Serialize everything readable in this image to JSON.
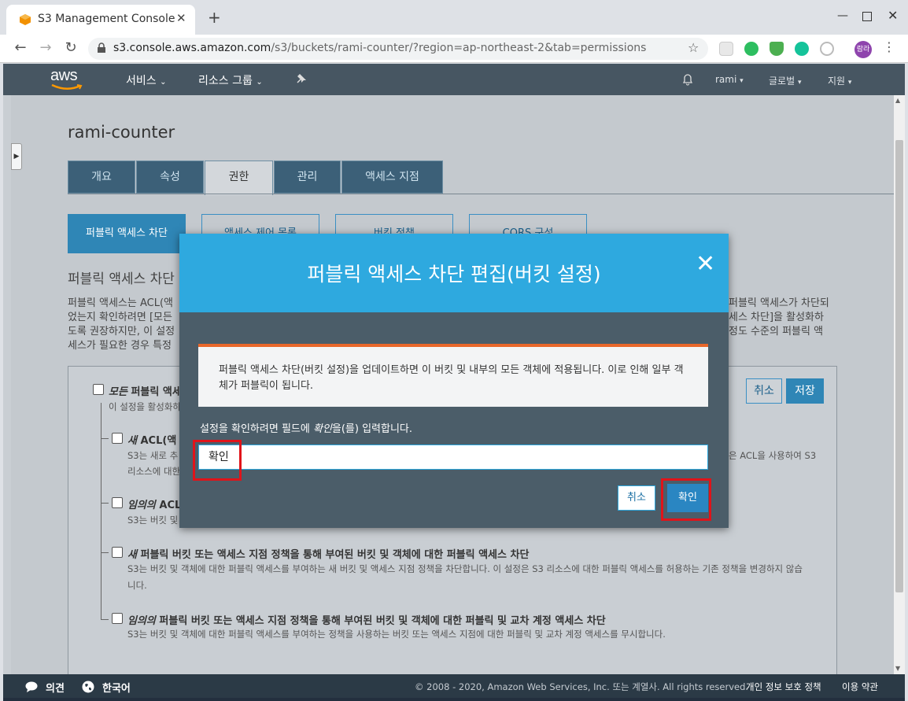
{
  "browser": {
    "tab_title": "S3 Management Console",
    "url_host": "s3.console.aws.amazon.com",
    "url_path": "/s3/buckets/rami-counter/?region=ap-northeast-2&tab=permissions",
    "profile_label": "람라"
  },
  "aws_nav": {
    "logo": "aws",
    "services": "서비스",
    "resource_groups": "리소스 그룹",
    "user": "rami",
    "region": "글로벌",
    "support": "지원"
  },
  "bucket": {
    "name": "rami-counter",
    "tabs": [
      "개요",
      "속성",
      "권한",
      "관리",
      "액세스 지점"
    ],
    "active_tab": "권한",
    "subtabs": [
      "퍼블릭 액세스 차단",
      "액세스 제어 목록",
      "버킷 정책",
      "CORS 구성"
    ]
  },
  "section": {
    "title": "퍼블릭 액세스 차단",
    "line1_left": "퍼블릭 액세스는 ACL(액",
    "line1_right": "퍼블릭 액세스가 차단되",
    "line2_left": "었는지 확인하려면 [모든",
    "line2_right": "세스 차단]을 활성화하",
    "line3_left": "도록 권장하지만, 이 설정",
    "line3_right": "정도 수준의 퍼블릭 액",
    "line4_left": "세스가 필요한 경우 특정"
  },
  "settings": {
    "cancel": "취소",
    "save": "저장",
    "all": {
      "em": "모든",
      "label": "퍼블릭 액세",
      "desc": "이 설정을 활성화하"
    },
    "opt1": {
      "em": "새",
      "label": "ACL(액",
      "desc1": "S3는 새로 추",
      "desc1_right": "은 ACL을 사용하여 S3",
      "desc2": "리소스에 대한"
    },
    "opt2": {
      "em": "임의의",
      "label": "ACL",
      "desc1": "S3는 버킷 및"
    },
    "opt3": {
      "em": "새",
      "label": "퍼블릭 버킷 또는 액세스 지점 정책을 통해 부여된 버킷 및 객체에 대한 퍼블릭 액세스 차단",
      "desc1": "S3는 버킷 및 객체에 대한 퍼블릭 액세스를 부여하는 새 버킷 및 액세스 지점 정책을 차단합니다. 이 설정은 S3 리소스에 대한 퍼블릭 액세스를 허용하는 기존 정책을 변경하지 않습",
      "desc2": "니다."
    },
    "opt4": {
      "em": "임의의",
      "label": "퍼블릭 버킷 또는 액세스 지점 정책을 통해 부여된 버킷 및 객체에 대한 퍼블릭 및 교차 계정 액세스 차단",
      "desc1": "S3는 버킷 및 객체에 대한 퍼블릭 액세스를 부여하는 정책을 사용하는 버킷 또는 액세스 지점에 대한 퍼블릭 및 교차 계정 액세스를 무시합니다."
    }
  },
  "modal": {
    "title": "퍼블릭 액세스 차단 편집(버킷 설정)",
    "alert": "퍼블릭 액세스 차단(버킷 설정)을 업데이트하면 이 버킷 및 내부의 모든 객체에 적용됩니다. 이로 인해 일부 객체가 퍼블릭이 됩니다.",
    "confirm_prefix": "설정을 확인하려면 필드에 ",
    "confirm_word": "확인",
    "confirm_suffix": "을(를) 입력합니다.",
    "input_value": "확인",
    "cancel": "취소",
    "ok": "확인"
  },
  "footer": {
    "feedback": "의견",
    "language": "한국어",
    "copyright": "© 2008 - 2020, Amazon Web Services, Inc. 또는 계열사. All rights reserved.",
    "privacy": "개인 정보 보호 정책",
    "terms": "이용 약관"
  }
}
